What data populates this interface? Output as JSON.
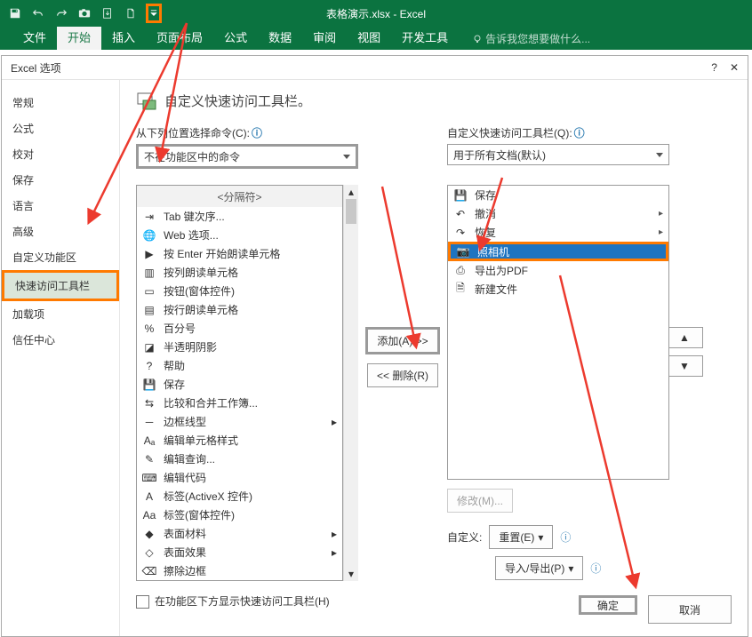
{
  "titlebar": {
    "title": "表格演示.xlsx - Excel"
  },
  "ribbon": {
    "tabs": [
      "文件",
      "开始",
      "插入",
      "页面布局",
      "公式",
      "数据",
      "审阅",
      "视图",
      "开发工具"
    ],
    "active_index": 1,
    "tell_me": "告诉我您想要做什么..."
  },
  "dialog": {
    "title": "Excel 选项",
    "sidebar": [
      "常规",
      "公式",
      "校对",
      "保存",
      "语言",
      "高级",
      "自定义功能区",
      "快速访问工具栏",
      "加载项",
      "信任中心"
    ],
    "sidebar_selected_index": 7,
    "heading": "自定义快速访问工具栏。",
    "left_label": "从下列位置选择命令(C):",
    "left_select": "不在功能区中的命令",
    "right_label": "自定义快速访问工具栏(Q):",
    "right_select": "用于所有文档(默认)",
    "commands": [
      "<分隔符>",
      "Tab 键次序...",
      "Web 选项...",
      "按 Enter 开始朗读单元格",
      "按列朗读单元格",
      "按钮(窗体控件)",
      "按行朗读单元格",
      "百分号",
      "半透明阴影",
      "帮助",
      "保存",
      "比较和合并工作簿...",
      "边框线型",
      "编辑单元格样式",
      "编辑查询...",
      "编辑代码",
      "标签(ActiveX 控件)",
      "标签(窗体控件)",
      "表面材料",
      "表面效果",
      "擦除边框"
    ],
    "qat_items": [
      "保存",
      "撤消",
      "恢复",
      "照相机",
      "导出为PDF",
      "新建文件"
    ],
    "qat_selected_index": 3,
    "add_btn": "添加(A) >>",
    "remove_btn": "<< 删除(R)",
    "modify_btn": "修改(M)...",
    "customize_label": "自定义:",
    "reset_btn": "重置(E)",
    "import_btn": "导入/导出(P)",
    "show_below": "在功能区下方显示快速访问工具栏(H)",
    "ok": "确定",
    "cancel": "取消"
  }
}
